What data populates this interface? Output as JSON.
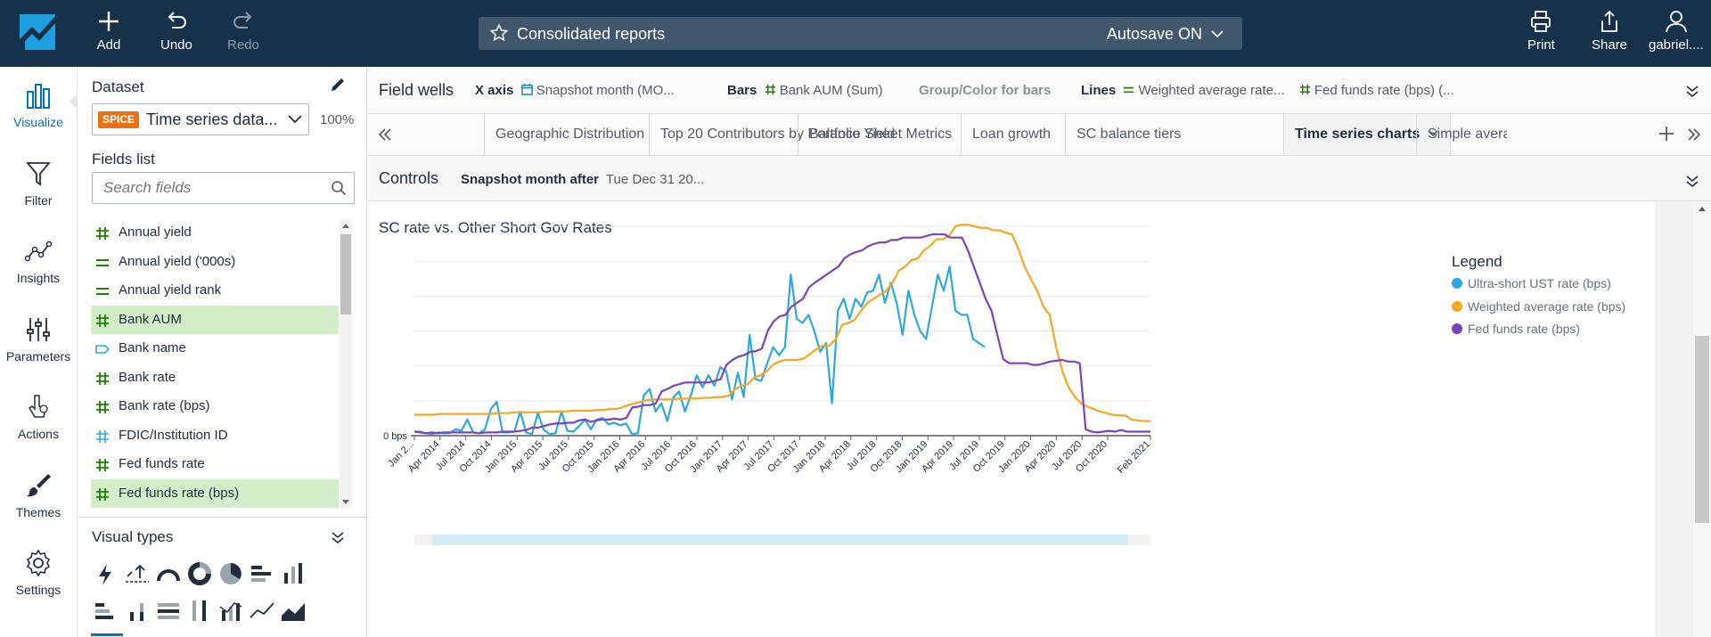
{
  "topbar": {
    "add_label": "Add",
    "undo_label": "Undo",
    "redo_label": "Redo",
    "analysis_title": "Consolidated reports",
    "autosave_label": "Autosave ON",
    "print_label": "Print",
    "share_label": "Share",
    "user_label": "gabriel...."
  },
  "rail": {
    "items": [
      {
        "label": "Visualize",
        "icon": "bar-chart-icon"
      },
      {
        "label": "Filter",
        "icon": "funnel-icon"
      },
      {
        "label": "Insights",
        "icon": "insights-icon"
      },
      {
        "label": "Parameters",
        "icon": "sliders-icon"
      },
      {
        "label": "Actions",
        "icon": "pointer-icon"
      },
      {
        "label": "Themes",
        "icon": "brush-icon"
      },
      {
        "label": "Settings",
        "icon": "gear-icon"
      }
    ]
  },
  "data_panel": {
    "dataset_title": "Dataset",
    "spice_badge": "SPICE",
    "dataset_name": "Time series data...",
    "spice_pct": "100%",
    "fields_title": "Fields list",
    "search_placeholder": "Search fields",
    "fields": [
      {
        "name": "Annual yield",
        "type": "measure",
        "selected": false
      },
      {
        "name": "Annual yield ('000s)",
        "type": "calc",
        "selected": false
      },
      {
        "name": "Annual yield rank",
        "type": "calc",
        "selected": false
      },
      {
        "name": "Bank AUM",
        "type": "measure",
        "selected": true
      },
      {
        "name": "Bank name",
        "type": "dimension",
        "selected": false
      },
      {
        "name": "Bank rate",
        "type": "measure",
        "selected": false
      },
      {
        "name": "Bank rate (bps)",
        "type": "measure",
        "selected": false
      },
      {
        "name": "FDIC/Institution ID",
        "type": "id",
        "selected": false
      },
      {
        "name": "Fed funds rate",
        "type": "measure",
        "selected": false
      },
      {
        "name": "Fed funds rate (bps)",
        "type": "measure",
        "selected": true
      }
    ],
    "visual_types_title": "Visual types"
  },
  "field_wells": {
    "title": "Field wells",
    "x_axis_label": "X axis",
    "x_axis_value": "Snapshot month (MO...",
    "bars_label": "Bars",
    "bars_value": "Bank AUM (Sum)",
    "group_label": "Group/Color for bars",
    "lines_label": "Lines",
    "lines_value_1": "Weighted average rate...",
    "lines_value_2": "Fed funds rate (bps) (..."
  },
  "sheet_tabs": [
    {
      "label": "Geographic Distribution",
      "active": false
    },
    {
      "label": "Top 20 Contributors by Portfolio Yield",
      "active": false
    },
    {
      "label": "Balance Sheet Metrics",
      "active": false
    },
    {
      "label": "Loan growth",
      "active": false
    },
    {
      "label": "SC balance tiers",
      "active": false
    },
    {
      "label": "Time series charts",
      "active": true
    },
    {
      "label": "Simple averag",
      "active": false
    }
  ],
  "controls": {
    "title": "Controls",
    "filter_name": "Snapshot month after",
    "filter_value": "Tue Dec 31 20..."
  },
  "visual": {
    "title": "SC rate vs. Other Short Gov Rates",
    "legend_title": "Legend"
  },
  "chart_data": {
    "type": "line",
    "title": "SC rate vs. Other Short Gov Rates",
    "ylabel": "",
    "xlabel": "",
    "y_tick_labels": [
      "0 bps"
    ],
    "x_tick_labels": [
      "Jan 2...",
      "Apr 2014",
      "Jul 2014",
      "Oct 2014",
      "Jan 2015",
      "Apr 2015",
      "Jul 2015",
      "Oct 2015",
      "Jan 2016",
      "Apr 2016",
      "Jul 2016",
      "Oct 2016",
      "Jan 2017",
      "Apr 2017",
      "Jul 2017",
      "Oct 2017",
      "Jan 2018",
      "Apr 2018",
      "Jul 2018",
      "Oct 2018",
      "Jan 2019",
      "Apr 2019",
      "Jul 2019",
      "Oct 2019",
      "Jan 2020",
      "Apr 2020",
      "Jul 2020",
      "Oct 2020",
      "Feb 2021"
    ],
    "legend_position": "right",
    "grid": true,
    "ylim": [
      0,
      260
    ],
    "x_start": "2014-01",
    "series": [
      {
        "name": "Ultra-short UST rate (bps)",
        "color": "#2ea8dc",
        "values": [
          5,
          5,
          3,
          2,
          4,
          3,
          3,
          8,
          6,
          20,
          4,
          3,
          8,
          33,
          42,
          4,
          4,
          5,
          30,
          4,
          2,
          28,
          7,
          2,
          3,
          30,
          6,
          5,
          12,
          20,
          8,
          20,
          22,
          14,
          16,
          13,
          15,
          2,
          3,
          50,
          58,
          30,
          40,
          18,
          47,
          55,
          30,
          50,
          75,
          60,
          75,
          62,
          85,
          80,
          45,
          78,
          48,
          125,
          70,
          68,
          90,
          110,
          100,
          110,
          200,
          145,
          140,
          150,
          130,
          104,
          115,
          40,
          155,
          170,
          145,
          170,
          160,
          178,
          180,
          200,
          165,
          190,
          165,
          125,
          180,
          150,
          130,
          120,
          160,
          200,
          180,
          210,
          155,
          150,
          150,
          120,
          115,
          110
        ]
      },
      {
        "name": "Weighted average rate (bps)",
        "color": "#f5a623",
        "values": [
          26,
          26,
          26,
          26,
          27,
          27,
          27,
          27,
          27,
          27,
          27,
          27,
          27,
          28,
          28,
          28,
          29,
          29,
          29,
          29,
          29,
          30,
          30,
          30,
          30,
          31,
          31,
          31,
          31,
          32,
          32,
          33,
          33,
          35,
          38,
          40,
          42,
          44,
          45,
          45,
          45,
          45,
          46,
          46,
          46,
          46,
          47,
          47,
          48,
          48,
          50,
          58,
          62,
          64,
          72,
          75,
          80,
          88,
          92,
          94,
          94,
          94,
          96,
          102,
          108,
          112,
          112,
          120,
          138,
          140,
          144,
          155,
          165,
          170,
          175,
          180,
          190,
          205,
          210,
          218,
          220,
          230,
          236,
          244,
          244,
          248,
          260,
          262,
          262,
          260,
          258,
          258,
          255,
          255,
          252,
          250,
          232,
          210,
          194,
          180,
          160,
          150,
          110,
          80,
          60,
          48,
          40,
          36,
          33,
          30,
          28,
          26,
          25,
          25,
          20,
          19,
          18,
          18
        ]
      },
      {
        "name": "Fed funds rate (bps)",
        "color": "#7b42bc",
        "values": [
          5,
          4,
          3,
          4,
          3,
          4,
          4,
          4,
          4,
          4,
          4,
          3,
          4,
          4,
          4,
          5,
          5,
          5,
          6,
          7,
          10,
          10,
          12,
          14,
          15,
          15,
          16,
          16,
          19,
          20,
          17,
          19,
          20,
          20,
          21,
          20,
          22,
          35,
          36,
          38,
          38,
          40,
          55,
          58,
          62,
          64,
          66,
          66,
          66,
          66,
          66,
          68,
          70,
          88,
          94,
          98,
          100,
          104,
          105,
          108,
          130,
          142,
          148,
          150,
          160,
          165,
          170,
          184,
          190,
          195,
          200,
          205,
          210,
          220,
          225,
          228,
          230,
          235,
          238,
          240,
          240,
          243,
          243,
          246,
          246,
          246,
          246,
          248,
          250,
          250,
          250,
          246,
          246,
          246,
          230,
          210,
          190,
          170,
          155,
          125,
          95,
          90,
          90,
          90,
          90,
          88,
          88,
          90,
          92,
          93,
          94,
          92,
          92,
          90,
          8,
          5,
          4,
          5,
          6,
          5,
          7,
          5,
          5,
          5,
          5,
          5
        ]
      }
    ]
  }
}
